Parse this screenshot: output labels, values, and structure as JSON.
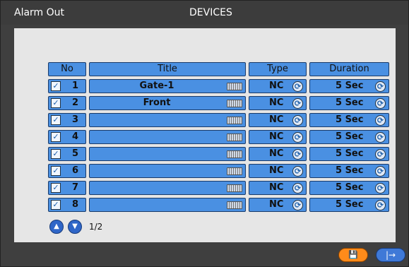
{
  "window": {
    "title_left": "Alarm Out",
    "title_center": "DEVICES"
  },
  "table": {
    "headers": [
      "No",
      "Title",
      "Type",
      "Duration"
    ],
    "rows": [
      {
        "no": "1",
        "title": "Gate-1",
        "type": "NC",
        "duration": "5 Sec",
        "checked": true
      },
      {
        "no": "2",
        "title": "Front",
        "type": "NC",
        "duration": "5 Sec",
        "checked": true
      },
      {
        "no": "3",
        "title": "",
        "type": "NC",
        "duration": "5 Sec",
        "checked": true
      },
      {
        "no": "4",
        "title": "",
        "type": "NC",
        "duration": "5 Sec",
        "checked": true
      },
      {
        "no": "5",
        "title": "",
        "type": "NC",
        "duration": "5 Sec",
        "checked": true
      },
      {
        "no": "6",
        "title": "",
        "type": "NC",
        "duration": "5 Sec",
        "checked": true
      },
      {
        "no": "7",
        "title": "",
        "type": "NC",
        "duration": "5 Sec",
        "checked": true
      },
      {
        "no": "8",
        "title": "",
        "type": "NC",
        "duration": "5 Sec",
        "checked": true
      }
    ]
  },
  "pagination": {
    "page": "1/2",
    "prev_icon": "arrow-up-icon",
    "next_icon": "arrow-down-icon"
  },
  "footer": {
    "save_icon": "save-icon",
    "exit_icon": "exit-icon"
  },
  "icons": {
    "keyboard": "keyboard-icon",
    "cycle": "cycle-icon",
    "check": "checkbox-icon"
  },
  "colors": {
    "cell_blue": "#4a90e2",
    "panel": "#e6e6e6",
    "window": "#3f3f3f",
    "save_orange": "#ff8b1a",
    "exit_blue": "#3f79d7"
  }
}
